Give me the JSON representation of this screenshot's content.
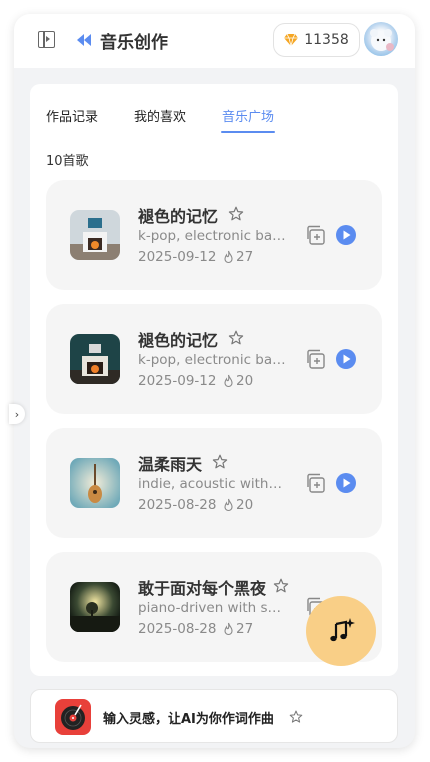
{
  "header": {
    "title": "音乐创作",
    "points": "11358",
    "sidebar_toggle_icon": "sidebar-toggle-icon",
    "back_icon": "double-chevron-left-icon",
    "points_icon": "diamond-icon"
  },
  "tabs": [
    {
      "label": "作品记录",
      "active": false
    },
    {
      "label": "我的喜欢",
      "active": false
    },
    {
      "label": "音乐广场",
      "active": true
    }
  ],
  "song_count": "10首歌",
  "songs": [
    {
      "title": "褪色的记忆",
      "tags": "k-pop, electronic ballad",
      "date": "2025-09-12",
      "likes": "27"
    },
    {
      "title": "褪色的记忆",
      "tags": "k-pop, electronic ballad",
      "date": "2025-09-12",
      "likes": "20"
    },
    {
      "title": "温柔雨天",
      "tags": "indie, acoustic with soft vocals",
      "date": "2025-08-28",
      "likes": "20"
    },
    {
      "title": "敢于面对每个黑夜",
      "tags": "piano-driven with soft vocals",
      "date": "2025-08-28",
      "likes": "27"
    }
  ],
  "prompt_bar": {
    "text": "输入灵感，让AI为你作词作曲"
  },
  "colors": {
    "accent": "#5b8cf0",
    "fab": "#f9cf87",
    "diamond": "#f5a623",
    "prompt_icon_bg": "#e8403a"
  }
}
